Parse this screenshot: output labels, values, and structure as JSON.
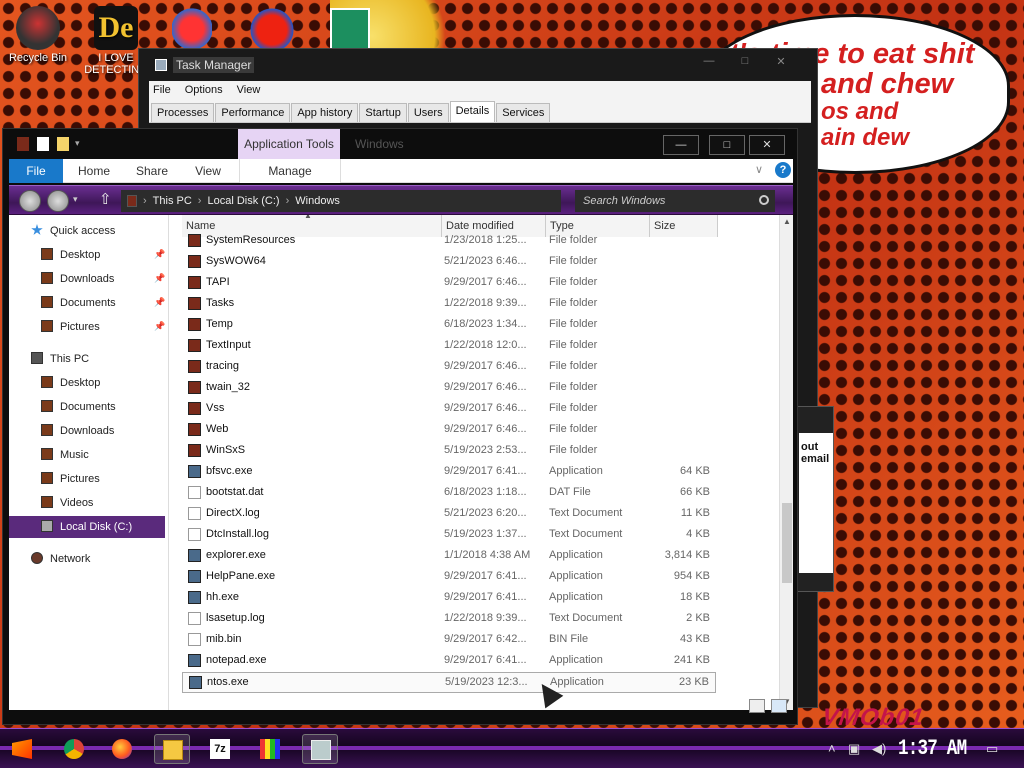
{
  "desktop": {
    "icons": [
      {
        "label": "Recycle Bin",
        "icon": "recycle-bin-icon"
      },
      {
        "label": "I LOVE DETECTING",
        "icon": "de-logo-icon"
      }
    ],
    "bubble_lines": [
      "it's time to eat shit",
      "and chew",
      "os and",
      "ain dew"
    ],
    "watermark": "VMOb01",
    "side_dialog_text": [
      "out",
      "email"
    ]
  },
  "task_manager": {
    "title": "Task Manager",
    "menu": [
      "File",
      "Options",
      "View"
    ],
    "tabs": [
      "Processes",
      "Performance",
      "App history",
      "Startup",
      "Users",
      "Details",
      "Services"
    ],
    "active_tab": "Details"
  },
  "explorer": {
    "title": "Windows",
    "app_tools_label": "Application Tools",
    "ribbon_tabs": [
      "File",
      "Home",
      "Share",
      "View",
      "Manage"
    ],
    "breadcrumb": [
      "This PC",
      "Local Disk (C:)",
      "Windows"
    ],
    "search_placeholder": "Search Windows",
    "nav": {
      "quick_access": "Quick access",
      "quick_items": [
        "Desktop",
        "Downloads",
        "Documents",
        "Pictures"
      ],
      "this_pc": "This PC",
      "pc_items": [
        "Desktop",
        "Documents",
        "Downloads",
        "Music",
        "Pictures",
        "Videos"
      ],
      "local_disk": "Local Disk (C:)",
      "network": "Network"
    },
    "columns": [
      "Name",
      "Date modified",
      "Type",
      "Size"
    ],
    "files": [
      {
        "name": "SystemResources",
        "date": "1/23/2018 1:25...",
        "type": "File folder",
        "size": "",
        "kind": "folder"
      },
      {
        "name": "SysWOW64",
        "date": "5/21/2023 6:46...",
        "type": "File folder",
        "size": "",
        "kind": "folder"
      },
      {
        "name": "TAPI",
        "date": "9/29/2017 6:46...",
        "type": "File folder",
        "size": "",
        "kind": "folder"
      },
      {
        "name": "Tasks",
        "date": "1/22/2018 9:39...",
        "type": "File folder",
        "size": "",
        "kind": "folder"
      },
      {
        "name": "Temp",
        "date": "6/18/2023 1:34...",
        "type": "File folder",
        "size": "",
        "kind": "folder"
      },
      {
        "name": "TextInput",
        "date": "1/22/2018 12:0...",
        "type": "File folder",
        "size": "",
        "kind": "folder"
      },
      {
        "name": "tracing",
        "date": "9/29/2017 6:46...",
        "type": "File folder",
        "size": "",
        "kind": "folder"
      },
      {
        "name": "twain_32",
        "date": "9/29/2017 6:46...",
        "type": "File folder",
        "size": "",
        "kind": "folder"
      },
      {
        "name": "Vss",
        "date": "9/29/2017 6:46...",
        "type": "File folder",
        "size": "",
        "kind": "folder"
      },
      {
        "name": "Web",
        "date": "9/29/2017 6:46...",
        "type": "File folder",
        "size": "",
        "kind": "folder"
      },
      {
        "name": "WinSxS",
        "date": "5/19/2023 2:53...",
        "type": "File folder",
        "size": "",
        "kind": "folder"
      },
      {
        "name": "bfsvc.exe",
        "date": "9/29/2017 6:41...",
        "type": "Application",
        "size": "64 KB",
        "kind": "app"
      },
      {
        "name": "bootstat.dat",
        "date": "6/18/2023 1:18...",
        "type": "DAT File",
        "size": "66 KB",
        "kind": "doc"
      },
      {
        "name": "DirectX.log",
        "date": "5/21/2023 6:20...",
        "type": "Text Document",
        "size": "11 KB",
        "kind": "doc"
      },
      {
        "name": "DtcInstall.log",
        "date": "5/19/2023 1:37...",
        "type": "Text Document",
        "size": "4 KB",
        "kind": "doc"
      },
      {
        "name": "explorer.exe",
        "date": "1/1/2018 4:38 AM",
        "type": "Application",
        "size": "3,814 KB",
        "kind": "app"
      },
      {
        "name": "HelpPane.exe",
        "date": "9/29/2017 6:41...",
        "type": "Application",
        "size": "954 KB",
        "kind": "app"
      },
      {
        "name": "hh.exe",
        "date": "9/29/2017 6:41...",
        "type": "Application",
        "size": "18 KB",
        "kind": "app"
      },
      {
        "name": "lsasetup.log",
        "date": "1/22/2018 9:39...",
        "type": "Text Document",
        "size": "2 KB",
        "kind": "doc"
      },
      {
        "name": "mib.bin",
        "date": "9/29/2017 6:42...",
        "type": "BIN File",
        "size": "43 KB",
        "kind": "doc"
      },
      {
        "name": "notepad.exe",
        "date": "9/29/2017 6:41...",
        "type": "Application",
        "size": "241 KB",
        "kind": "app"
      },
      {
        "name": "ntos.exe",
        "date": "5/19/2023 12:3...",
        "type": "Application",
        "size": "23 KB",
        "kind": "app"
      }
    ],
    "selected_file": "ntos.exe"
  },
  "taskbar": {
    "apps": [
      "start-icon",
      "chrome-icon",
      "firefox-icon",
      "file-explorer-icon",
      "7zip-icon",
      "paint-icon",
      "task-manager-icon"
    ],
    "clock": "1:37 AM"
  },
  "colors": {
    "accent": "#5a2a7c",
    "file_tab": "#1979ca",
    "app_tools": "#e6d4f4"
  }
}
